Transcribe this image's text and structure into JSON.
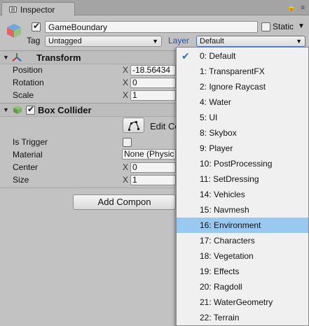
{
  "tab": {
    "label": "Inspector"
  },
  "header": {
    "object_name": "GameBoundary",
    "active": true,
    "static_label": "Static",
    "static_checked": false,
    "tag_label": "Tag",
    "tag_value": "Untagged",
    "layer_label": "Layer",
    "layer_value": "Default"
  },
  "transform": {
    "title": "Transform",
    "rows": [
      {
        "label": "Position",
        "axis": "X",
        "value": "-18.56434"
      },
      {
        "label": "Rotation",
        "axis": "X",
        "value": "0"
      },
      {
        "label": "Scale",
        "axis": "X",
        "value": "1"
      }
    ]
  },
  "box_collider": {
    "title": "Box Collider",
    "enabled": true,
    "edit_label": "Edit Co",
    "is_trigger_label": "Is Trigger",
    "material_label": "Material",
    "material_value": "None (Physic",
    "center_label": "Center",
    "center_axis": "X",
    "center_value": "0",
    "size_label": "Size",
    "size_axis": "X",
    "size_value": "1"
  },
  "add_component": {
    "label": "Add Compon"
  },
  "layer_menu": {
    "items": [
      {
        "label": "0: Default",
        "checked": true
      },
      {
        "label": "1: TransparentFX"
      },
      {
        "label": "2: Ignore Raycast"
      },
      {
        "label": "4: Water"
      },
      {
        "label": "5: UI"
      },
      {
        "label": "8: Skybox"
      },
      {
        "label": "9: Player"
      },
      {
        "label": "10: PostProcessing"
      },
      {
        "label": "11: SetDressing"
      },
      {
        "label": "14: Vehicles"
      },
      {
        "label": "15: Navmesh"
      },
      {
        "label": "16: Environment",
        "highlighted": true
      },
      {
        "label": "17: Characters"
      },
      {
        "label": "18: Vegetation"
      },
      {
        "label": "19: Effects"
      },
      {
        "label": "20: Ragdoll"
      },
      {
        "label": "21: WaterGeometry"
      },
      {
        "label": "22: Terrain"
      }
    ]
  },
  "icons": {
    "tab": "inspector-icon",
    "object": "gameobject-cube-icon",
    "lock": "lock-icon",
    "menu": "context-menu-icon",
    "transform": "transform-icon",
    "collider": "box-collider-icon",
    "edit": "edit-collider-icon"
  }
}
